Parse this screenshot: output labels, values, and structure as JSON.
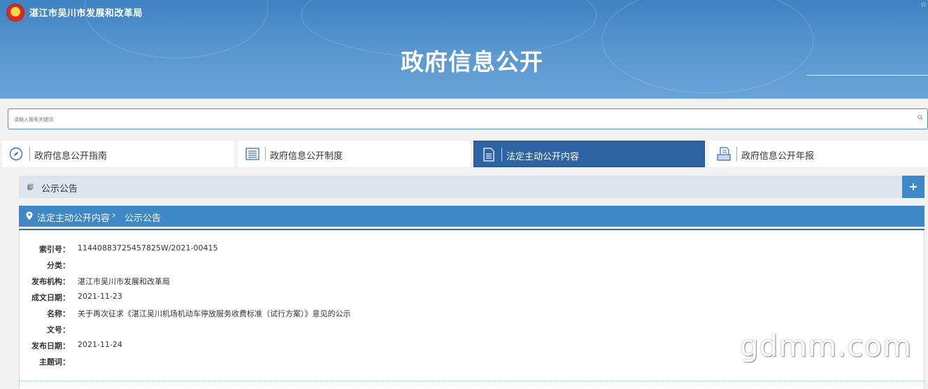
{
  "header": {
    "site_name": "湛江市吴川市发展和改革局",
    "page_heading": "政府信息公开"
  },
  "search": {
    "placeholder": "请输入搜索关键词"
  },
  "tabs": [
    {
      "label": "政府信息公开指南",
      "icon": "compass-icon",
      "active": false
    },
    {
      "label": "政府信息公开制度",
      "icon": "list-icon",
      "active": false
    },
    {
      "label": "法定主动公开内容",
      "icon": "document-icon",
      "active": true
    },
    {
      "label": "政府信息公开年报",
      "icon": "report-icon",
      "active": false
    }
  ],
  "notice_bar": {
    "label": "公示公告",
    "expand": "+"
  },
  "breadcrumb": {
    "items": [
      "法定主动公开内容",
      "公示公告"
    ],
    "separator": "›"
  },
  "info": [
    {
      "key": "索引号：",
      "value": "11440883725457825W/2021-00415"
    },
    {
      "key": "分类：",
      "value": ""
    },
    {
      "key": "发布机构：",
      "value": "湛江市吴川市发展和改革局"
    },
    {
      "key": "成文日期：",
      "value": "2021-11-23"
    },
    {
      "key": "名称：",
      "value": "关于再次征求《湛江吴川机场机动车停放服务收费标准（试行方案）》意见的公示"
    },
    {
      "key": "文号：",
      "value": ""
    },
    {
      "key": "发布日期：",
      "value": "2021-11-24"
    },
    {
      "key": "主题词：",
      "value": ""
    }
  ],
  "watermark": "gdmm.com",
  "colors": {
    "banner": "#4f8fcb",
    "active_tab": "#2e64a4",
    "accent": "#3f88c7",
    "notice_bg": "#dde6ef"
  }
}
